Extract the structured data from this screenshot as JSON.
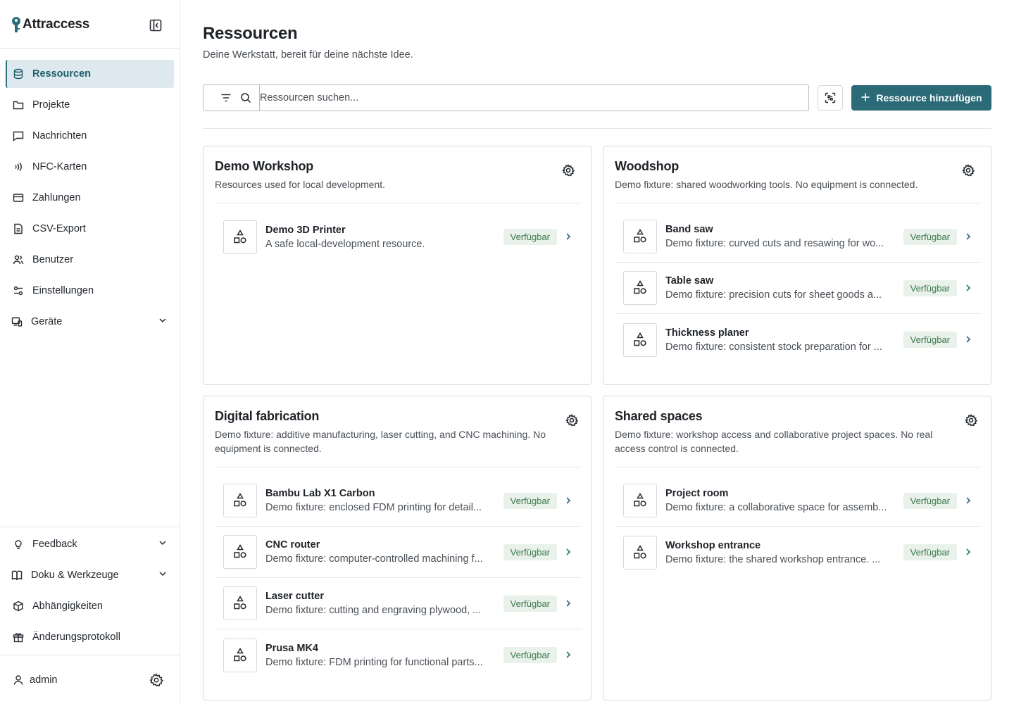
{
  "app": {
    "name": "Attraccess"
  },
  "sidebar": {
    "items": [
      {
        "label": "Ressourcen",
        "icon": "database-icon",
        "active": true
      },
      {
        "label": "Projekte",
        "icon": "folder-icon"
      },
      {
        "label": "Nachrichten",
        "icon": "message-icon"
      },
      {
        "label": "NFC-Karten",
        "icon": "nfc-icon"
      },
      {
        "label": "Zahlungen",
        "icon": "credit-card-icon"
      },
      {
        "label": "CSV-Export",
        "icon": "file-export-icon"
      },
      {
        "label": "Benutzer",
        "icon": "users-icon"
      },
      {
        "label": "Einstellungen",
        "icon": "settings-sliders-icon"
      },
      {
        "label": "Geräte",
        "icon": "devices-icon"
      }
    ],
    "bottom_items": [
      {
        "label": "Feedback",
        "icon": "lightbulb-icon"
      },
      {
        "label": "Doku & Werkzeuge",
        "icon": "book-icon"
      },
      {
        "label": "Abhängigkeiten",
        "icon": "package-icon"
      },
      {
        "label": "Änderungsprotokoll",
        "icon": "gift-icon"
      }
    ],
    "user": "admin"
  },
  "page": {
    "title": "Ressourcen",
    "subtitle": "Deine Werkstatt, bereit für deine nächste Idee.",
    "search_placeholder": "Ressourcen suchen...",
    "add_button": "Ressource hinzufügen"
  },
  "colors": {
    "accent": "#2a6b77",
    "badge_bg": "#e8f1ea",
    "badge_text": "#3c7a4e",
    "active_nav_bg": "#dde9ee"
  },
  "groups": [
    {
      "title": "Demo Workshop",
      "description": "Resources used for local development.",
      "resources": [
        {
          "name": "Demo 3D Printer",
          "description": "A safe local-development resource.",
          "status": "Verfügbar"
        }
      ]
    },
    {
      "title": "Woodshop",
      "description": "Demo fixture: shared woodworking tools. No equipment is connected.",
      "resources": [
        {
          "name": "Band saw",
          "description": "Demo fixture: curved cuts and resawing for wo...",
          "status": "Verfügbar"
        },
        {
          "name": "Table saw",
          "description": "Demo fixture: precision cuts for sheet goods a...",
          "status": "Verfügbar"
        },
        {
          "name": "Thickness planer",
          "description": "Demo fixture: consistent stock preparation for ...",
          "status": "Verfügbar"
        }
      ]
    },
    {
      "title": "Digital fabrication",
      "description": "Demo fixture: additive manufacturing, laser cutting, and CNC machining. No equipment is connected.",
      "resources": [
        {
          "name": "Bambu Lab X1 Carbon",
          "description": "Demo fixture: enclosed FDM printing for detail...",
          "status": "Verfügbar"
        },
        {
          "name": "CNC router",
          "description": "Demo fixture: computer-controlled machining f...",
          "status": "Verfügbar"
        },
        {
          "name": "Laser cutter",
          "description": "Demo fixture: cutting and engraving plywood, ...",
          "status": "Verfügbar"
        },
        {
          "name": "Prusa MK4",
          "description": "Demo fixture: FDM printing for functional parts...",
          "status": "Verfügbar"
        }
      ]
    },
    {
      "title": "Shared spaces",
      "description": "Demo fixture: workshop access and collaborative project spaces. No real access control is connected.",
      "resources": [
        {
          "name": "Project room",
          "description": "Demo fixture: a collaborative space for assemb...",
          "status": "Verfügbar"
        },
        {
          "name": "Workshop entrance",
          "description": "Demo fixture: the shared workshop entrance. ...",
          "status": "Verfügbar"
        }
      ]
    }
  ]
}
